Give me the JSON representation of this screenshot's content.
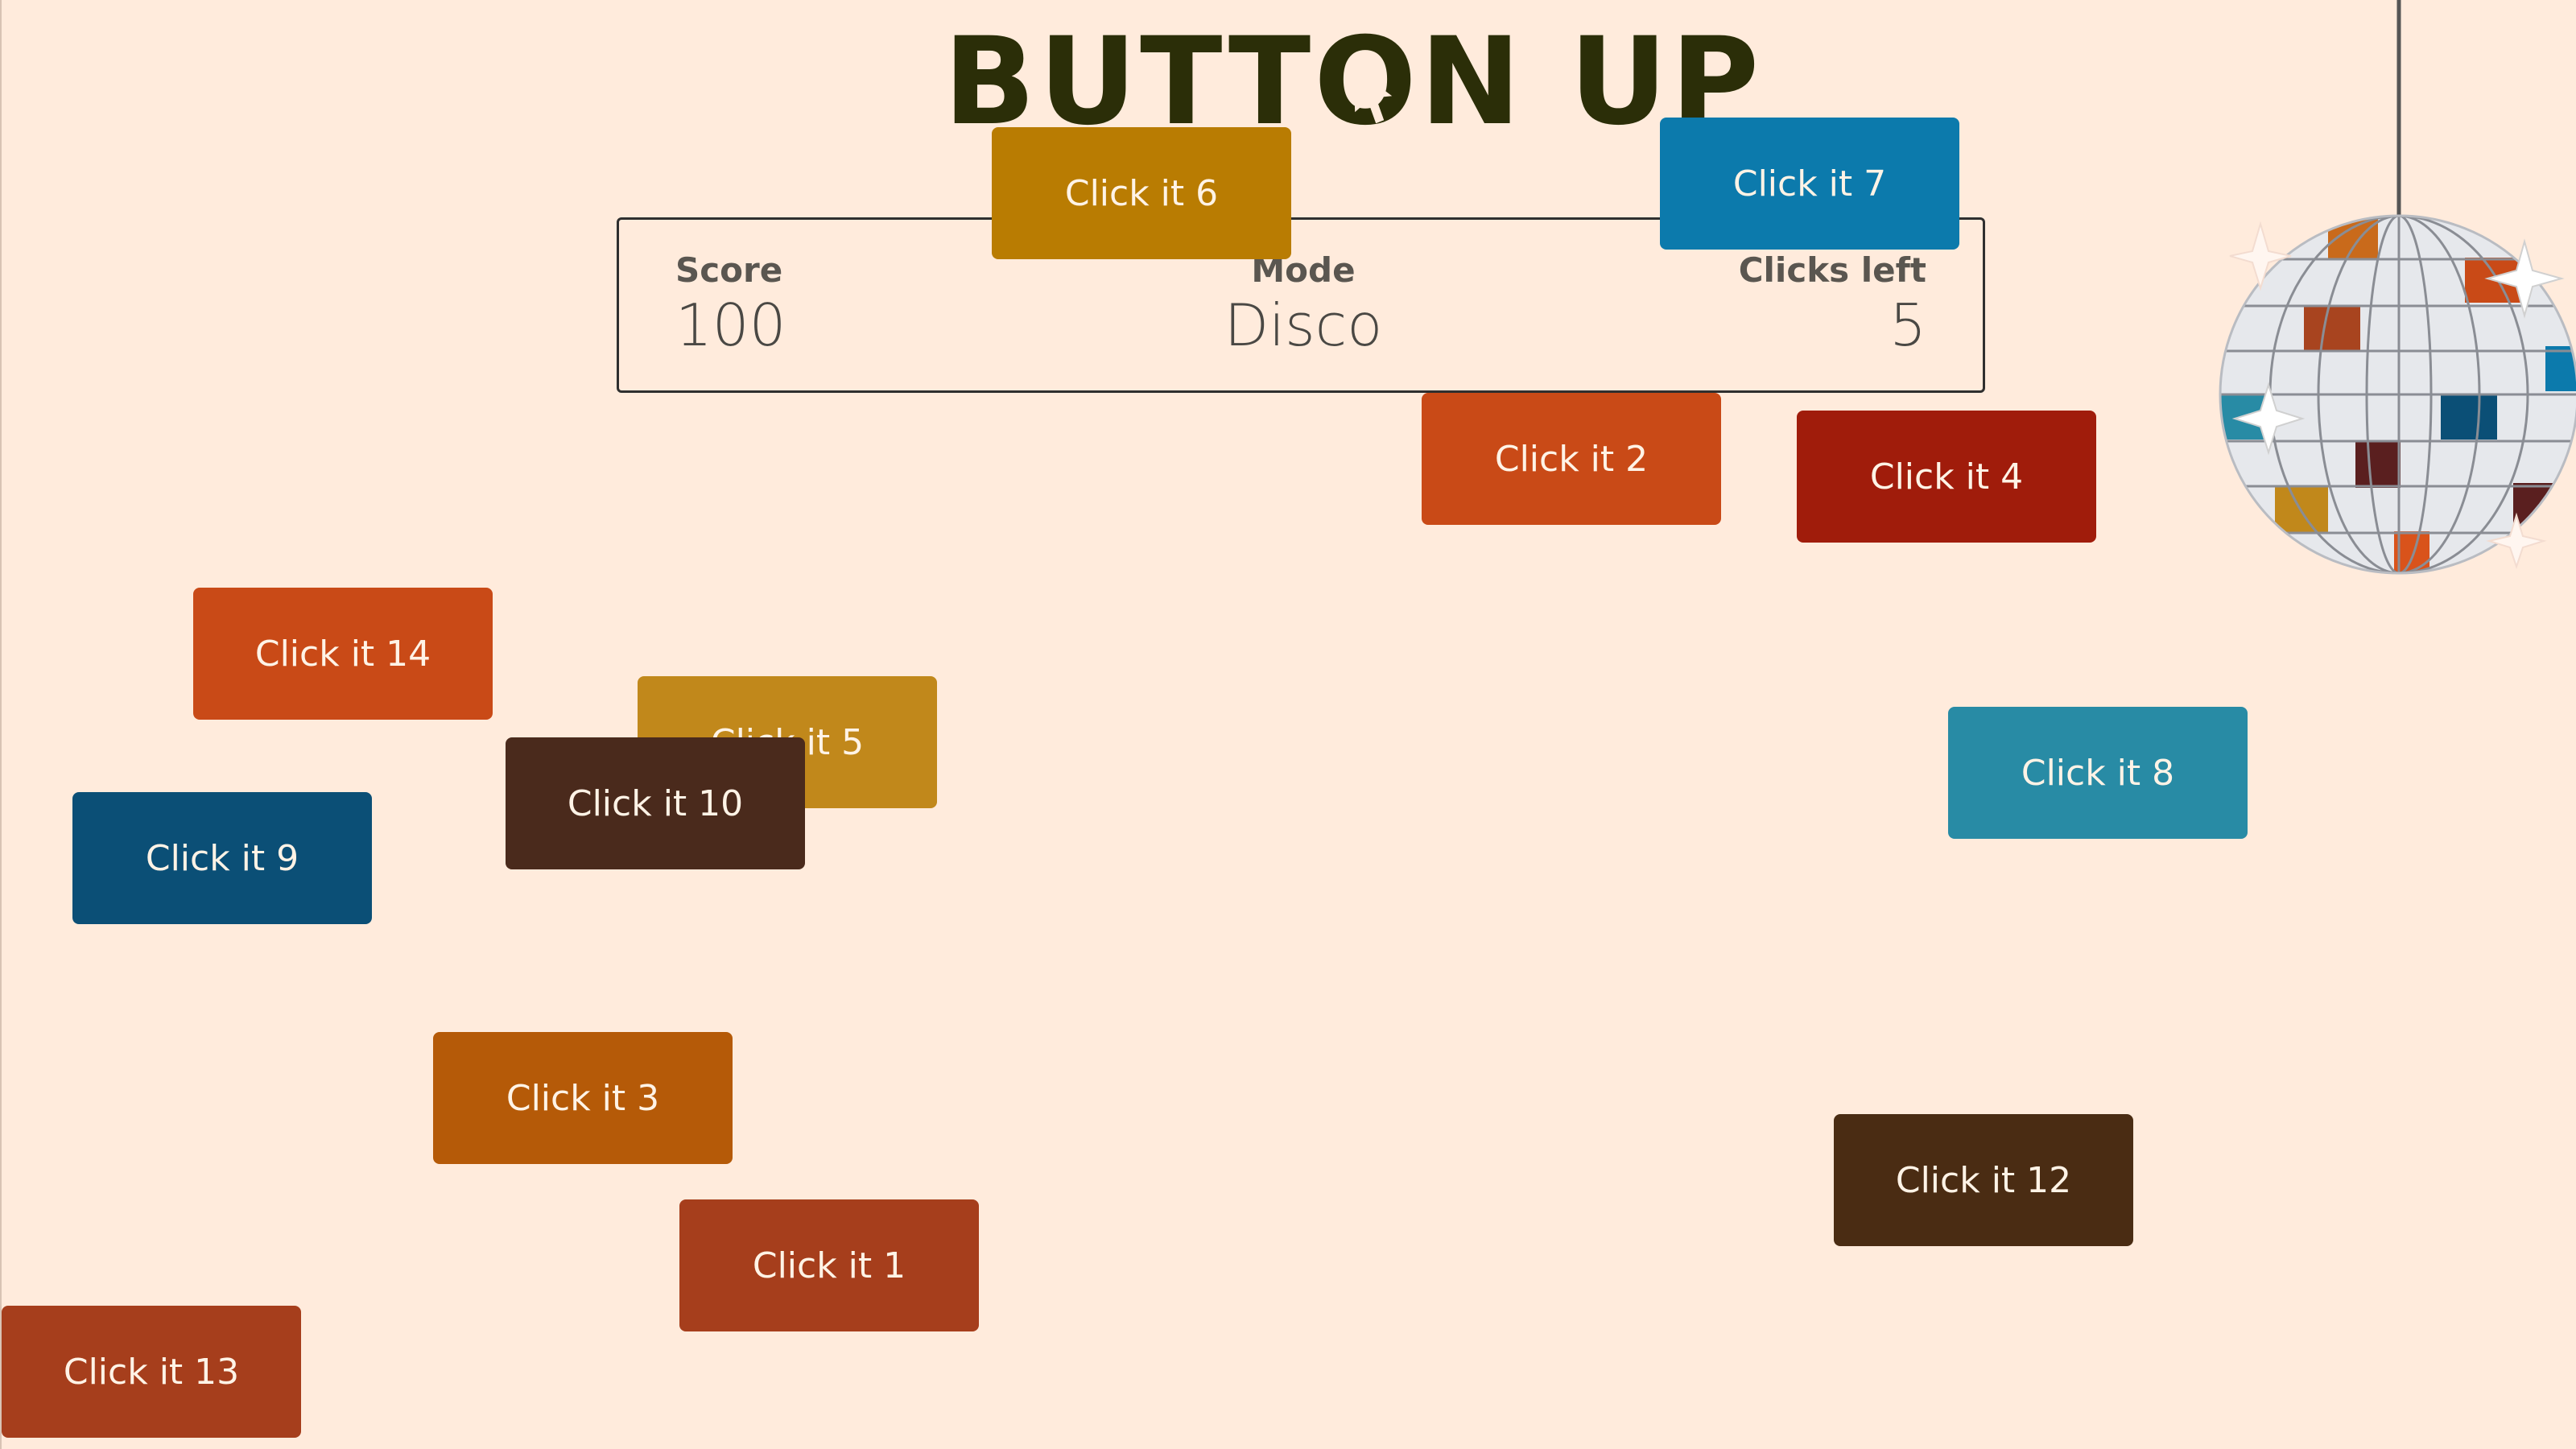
{
  "app": {
    "title_part1": "BUTT",
    "title_part2": "N UP",
    "title_full": "BUTTON UP"
  },
  "scoreboard": {
    "score_label": "Score",
    "score_value": "100",
    "mode_label": "Mode",
    "mode_value": "Disco",
    "clicks_label": "Clicks left",
    "clicks_value": "5"
  },
  "buttons": {
    "b1": "Click it 1",
    "b2": "Click it 2",
    "b3": "Click it 3",
    "b4": "Click it 4",
    "b5": "Click it 5",
    "b6": "Click it 6",
    "b7": "Click it 7",
    "b8": "Click it 8",
    "b9": "Click it 9",
    "b10": "Click it 10",
    "b12": "Click it 12",
    "b13": "Click it 13",
    "b14": "Click it 14"
  },
  "icons": {
    "title_o": "cursor-arrow-icon",
    "decoration": "disco-ball-icon"
  },
  "colors": {
    "background": "#ffebdc",
    "title": "#2b2e08"
  }
}
